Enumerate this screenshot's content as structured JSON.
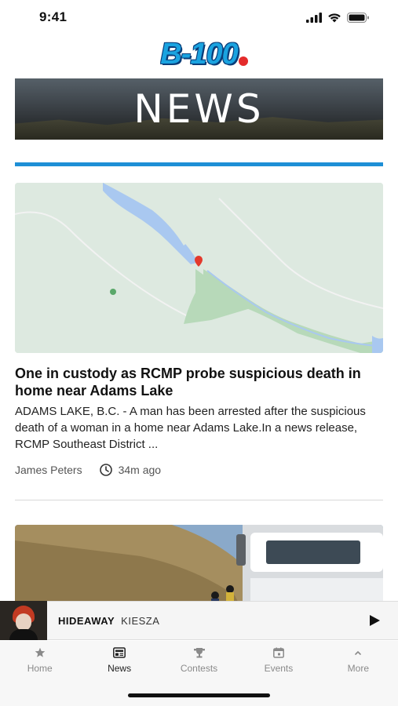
{
  "status": {
    "time": "9:41"
  },
  "logo": {
    "text": "B-100"
  },
  "banner": {
    "title": "NEWS"
  },
  "articles": [
    {
      "title": "One in custody as RCMP probe suspicious death in home near Adams Lake",
      "excerpt": "ADAMS LAKE, B.C. - A man has been arrested after the suspicious death of a woman in a home near Adams Lake.In a news release, RCMP Southeast District ...",
      "author": "James Peters",
      "time_ago": "34m ago"
    }
  ],
  "player": {
    "song": "HIDEAWAY",
    "artist": "KIESZA"
  },
  "tabs": [
    {
      "label": "Home",
      "icon": "star-icon"
    },
    {
      "label": "News",
      "icon": "newspaper-icon"
    },
    {
      "label": "Contests",
      "icon": "trophy-icon"
    },
    {
      "label": "Events",
      "icon": "calendar-icon"
    },
    {
      "label": "More",
      "icon": "chevron-up-icon"
    }
  ],
  "colors": {
    "accent": "#1e8fd6",
    "logo": "#1aa3e0"
  }
}
